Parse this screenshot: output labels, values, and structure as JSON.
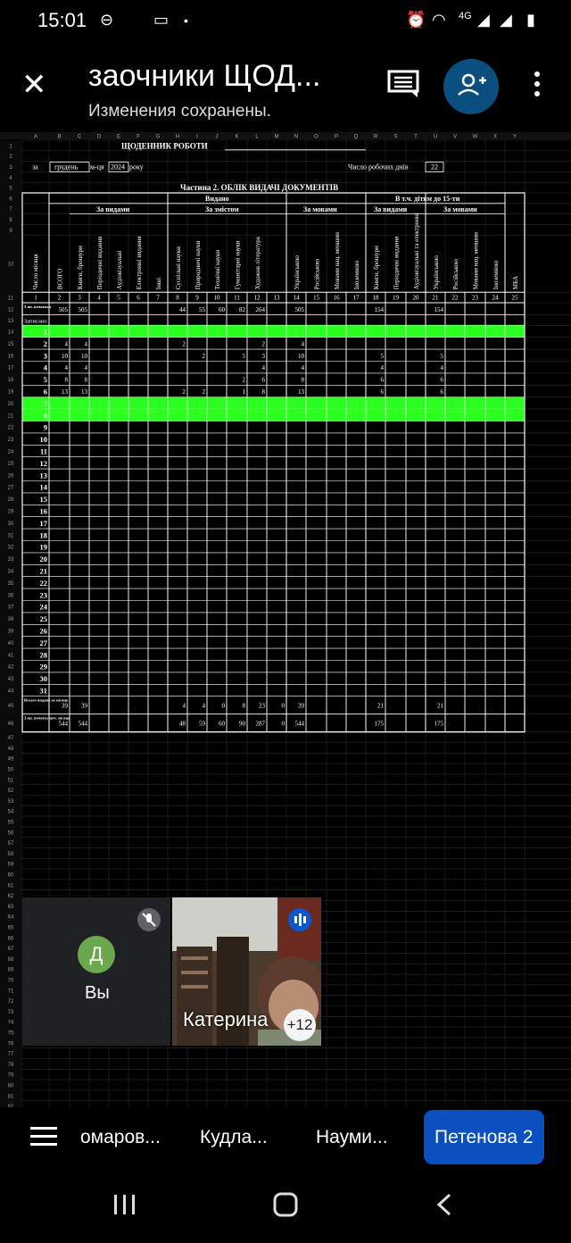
{
  "status": {
    "time": "15:01",
    "network_label": "4G",
    "battery": "battery-icon"
  },
  "header": {
    "title": "заочники  ЩОД...",
    "subtitle": "Изменения сохранены."
  },
  "sheet": {
    "col_letters": [
      "A",
      "B",
      "C",
      "D",
      "E",
      "F",
      "G",
      "H",
      "I",
      "J",
      "K",
      "L",
      "M",
      "N",
      "O",
      "P",
      "Q",
      "R",
      "S",
      "T",
      "U",
      "V",
      "W",
      "X",
      "Y"
    ],
    "doc_title": "ЩОДЕННИК РОБОТИ",
    "za": "за",
    "month": "грудень",
    "mcya": "м-ця",
    "year": "2024",
    "roku": "року",
    "workdays_label": "Число робочих днів",
    "workdays": "22",
    "section_title": "Частина 2. ОБЛІК ВИДАЧІ ДОКУМЕНТІВ",
    "h_vydano": "Видано",
    "h_children": "В т.ч. дітям до 15-ти",
    "h_za_vydamy": "За видами",
    "h_za_zmistom": "За змістом",
    "h_za_movamy": "За мовами",
    "h_za_vydamy2": "За видами",
    "h_za_movamy2": "За мовами",
    "h_day": "Число місяця",
    "col_heads": [
      "ВСОГО",
      "Книги, брошури",
      "Періодичні видання",
      "Аудіовізуальні",
      "Електронні видання",
      "Інші",
      "Суспільні науки",
      "Природничі науки",
      "Технічні науки",
      "Гуманітарні науки",
      "Художня література",
      "",
      "Українською",
      "Російською",
      "Мовами нац. меншин",
      "Іноземною",
      "Книги, брошури",
      "Періодичні видання",
      "Аудіовізуальні та електронні",
      "Українською",
      "Російською",
      "Мовами нац. меншин",
      "Іноземною",
      "МБА"
    ],
    "col_nums": [
      "1",
      "2",
      "3",
      "4",
      "5",
      "6",
      "7",
      "8",
      "9",
      "10",
      "11",
      "12",
      "13",
      "14",
      "15",
      "16",
      "17",
      "18",
      "19",
      "20",
      "21",
      "22",
      "23",
      "24",
      "25"
    ],
    "row_start_label": "З пп. початком",
    "row_start_values": [
      "505",
      "505",
      "",
      "",
      "",
      "",
      "44",
      "55",
      "60",
      "82",
      "264",
      "",
      "505",
      "",
      "",
      "",
      "154",
      "",
      "",
      "154",
      "",
      "",
      "",
      ""
    ],
    "row_zapysano": "Записано",
    "days": [
      {
        "d": "1",
        "green": true,
        "v": {}
      },
      {
        "d": "2",
        "green": false,
        "v": {
          "B": "4",
          "C": "4",
          "H": "2",
          "L": "2",
          "N": "4"
        }
      },
      {
        "d": "3",
        "green": false,
        "v": {
          "B": "10",
          "C": "10",
          "I": "2",
          "K": "5",
          "L": "3",
          "N": "10",
          "R": "5",
          "U": "5"
        }
      },
      {
        "d": "4",
        "green": false,
        "v": {
          "B": "4",
          "C": "4",
          "L": "4",
          "N": "4",
          "R": "4",
          "U": "4"
        }
      },
      {
        "d": "5",
        "green": false,
        "v": {
          "B": "8",
          "C": "8",
          "K": "2",
          "L": "6",
          "N": "8",
          "R": "6",
          "U": "6"
        }
      },
      {
        "d": "6",
        "green": false,
        "v": {
          "B": "13",
          "C": "13",
          "H": "2",
          "I": "2",
          "K": "1",
          "L": "8",
          "N": "13",
          "R": "6",
          "U": "6"
        }
      },
      {
        "d": "7",
        "green": true,
        "v": {}
      },
      {
        "d": "8",
        "green": true,
        "v": {}
      },
      {
        "d": "9",
        "green": false,
        "v": {}
      },
      {
        "d": "10",
        "green": false,
        "v": {}
      },
      {
        "d": "11",
        "green": false,
        "v": {}
      },
      {
        "d": "12",
        "green": false,
        "v": {}
      },
      {
        "d": "13",
        "green": false,
        "v": {}
      },
      {
        "d": "14",
        "green": false,
        "v": {}
      },
      {
        "d": "15",
        "green": false,
        "v": {}
      },
      {
        "d": "16",
        "green": false,
        "v": {}
      },
      {
        "d": "17",
        "green": false,
        "v": {}
      },
      {
        "d": "18",
        "green": false,
        "v": {}
      },
      {
        "d": "19",
        "green": false,
        "v": {}
      },
      {
        "d": "20",
        "green": false,
        "v": {}
      },
      {
        "d": "21",
        "green": false,
        "v": {}
      },
      {
        "d": "22",
        "green": false,
        "v": {}
      },
      {
        "d": "23",
        "green": false,
        "v": {}
      },
      {
        "d": "24",
        "green": false,
        "v": {}
      },
      {
        "d": "25",
        "green": false,
        "v": {}
      },
      {
        "d": "26",
        "green": false,
        "v": {}
      },
      {
        "d": "27",
        "green": false,
        "v": {}
      },
      {
        "d": "28",
        "green": false,
        "v": {}
      },
      {
        "d": "29",
        "green": false,
        "v": {}
      },
      {
        "d": "30",
        "green": false,
        "v": {}
      },
      {
        "d": "31",
        "green": false,
        "v": {}
      }
    ],
    "row_total_label": "Всього видано за місяць",
    "row_total_values": [
      "39",
      "39",
      "",
      "",
      "",
      "",
      "4",
      "4",
      "0",
      "8",
      "23",
      "0",
      "39",
      "",
      "",
      "",
      "21",
      "",
      "",
      "21",
      "",
      "",
      "",
      ""
    ],
    "row_cumulative_label": "З пп. початку поч. місяця",
    "row_cumulative_values": [
      "544",
      "544",
      "",
      "",
      "",
      "",
      "48",
      "59",
      "60",
      "90",
      "287",
      "0",
      "544",
      "",
      "",
      "",
      "175",
      "",
      "",
      "175",
      "",
      "",
      "",
      ""
    ],
    "row_numbers": [
      "1",
      "2",
      "3",
      "4",
      "5",
      "6",
      "7",
      "8",
      "9",
      "10",
      "11",
      "12",
      "13",
      "14",
      "15",
      "16",
      "17",
      "18",
      "19",
      "20",
      "21",
      "22",
      "23",
      "24",
      "25",
      "26",
      "27",
      "28",
      "29",
      "30",
      "31",
      "32",
      "33",
      "34",
      "35",
      "36",
      "37",
      "38",
      "39",
      "40",
      "41",
      "42",
      "43",
      "44",
      "45",
      "46",
      "47",
      "48",
      "49",
      "50",
      "51",
      "52",
      "53",
      "54",
      "55",
      "56",
      "57",
      "58",
      "59",
      "60",
      "61",
      "62",
      "63",
      "64",
      "65",
      "66",
      "67",
      "68",
      "69",
      "70",
      "71",
      "72",
      "73",
      "74",
      "75",
      "76",
      "77",
      "78",
      "79",
      "80",
      "81",
      "82"
    ]
  },
  "meet": {
    "you_initial": "Д",
    "you_label": "Вы",
    "participant_name": "Катерина",
    "extra_count": "+12"
  },
  "tabs": [
    {
      "label": "омаров..."
    },
    {
      "label": "Кудла..."
    },
    {
      "label": "Науми..."
    },
    {
      "label": "Петенова 2",
      "active": true
    }
  ],
  "colors": {
    "green_row": "#2bff1f",
    "accent": "#0b4fc0",
    "add_button": "#0b4f80"
  }
}
